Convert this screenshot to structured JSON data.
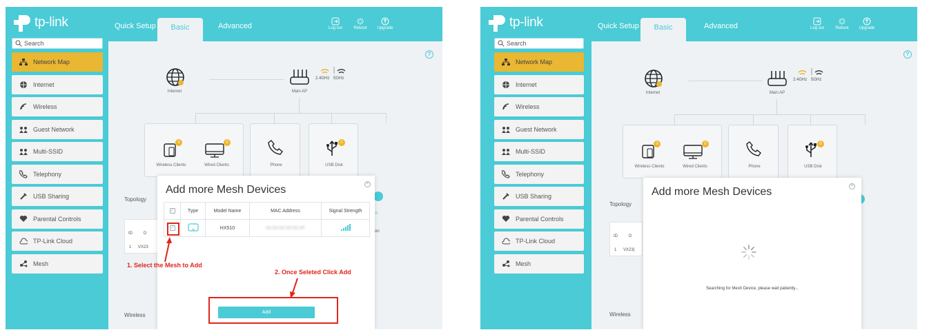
{
  "brand": "tp-link",
  "tabs": [
    "Quick Setup",
    "Basic",
    "Advanced"
  ],
  "top_actions": [
    "Log out",
    "Reboot",
    "Upgrade"
  ],
  "search_placeholder": "Search",
  "nav": [
    {
      "label": "Network Map",
      "icon": "network-map-icon",
      "selected": true
    },
    {
      "label": "Internet",
      "icon": "globe-icon"
    },
    {
      "label": "Wireless",
      "icon": "wifi-icon"
    },
    {
      "label": "Guest Network",
      "icon": "guest-icon"
    },
    {
      "label": "Multi-SSID",
      "icon": "users-icon"
    },
    {
      "label": "Telephony",
      "icon": "phone-icon"
    },
    {
      "label": "USB Sharing",
      "icon": "usb-icon"
    },
    {
      "label": "Parental Controls",
      "icon": "heart-icon"
    },
    {
      "label": "TP-Link Cloud",
      "icon": "cloud-icon"
    },
    {
      "label": "Mesh",
      "icon": "mesh-icon"
    }
  ],
  "map": {
    "internet": "Internet",
    "main_ap": "Main AP",
    "band_24": "2.4GHz",
    "band_5": "5GHz",
    "wireless_clients": "Wireless Clients",
    "wireless_count": "0",
    "wired_clients": "Wired Clients",
    "wired_count": "0",
    "phone": "Phone",
    "usb_disk": "USB Disk",
    "usb_count": "0"
  },
  "behind": {
    "topology": "Topology",
    "id_header": "ID",
    "row_id": "1",
    "row_name_left": "VX23",
    "row_name_right": "VX23(",
    "col_d": "D",
    "col_on": "on",
    "col_h": "h",
    "wireless": "Wireless"
  },
  "modal": {
    "title": "Add more Mesh Devices",
    "columns": [
      "Type",
      "Model Name",
      "MAC Address",
      "Signal Strength"
    ],
    "row": {
      "model": "HX510",
      "mac": "00:00:00:00:00:0F"
    },
    "add_label": "Add",
    "searching_text": "Searching for Mesh Device, please wait patiently..."
  },
  "annotations": {
    "step1": "1. Select the Mesh to Add",
    "step2": "2. Once Seleted Click Add"
  },
  "colors": {
    "teal": "#4acbd6",
    "gold": "#e9b731",
    "red": "#e0251b",
    "badge": "#f0b429"
  }
}
